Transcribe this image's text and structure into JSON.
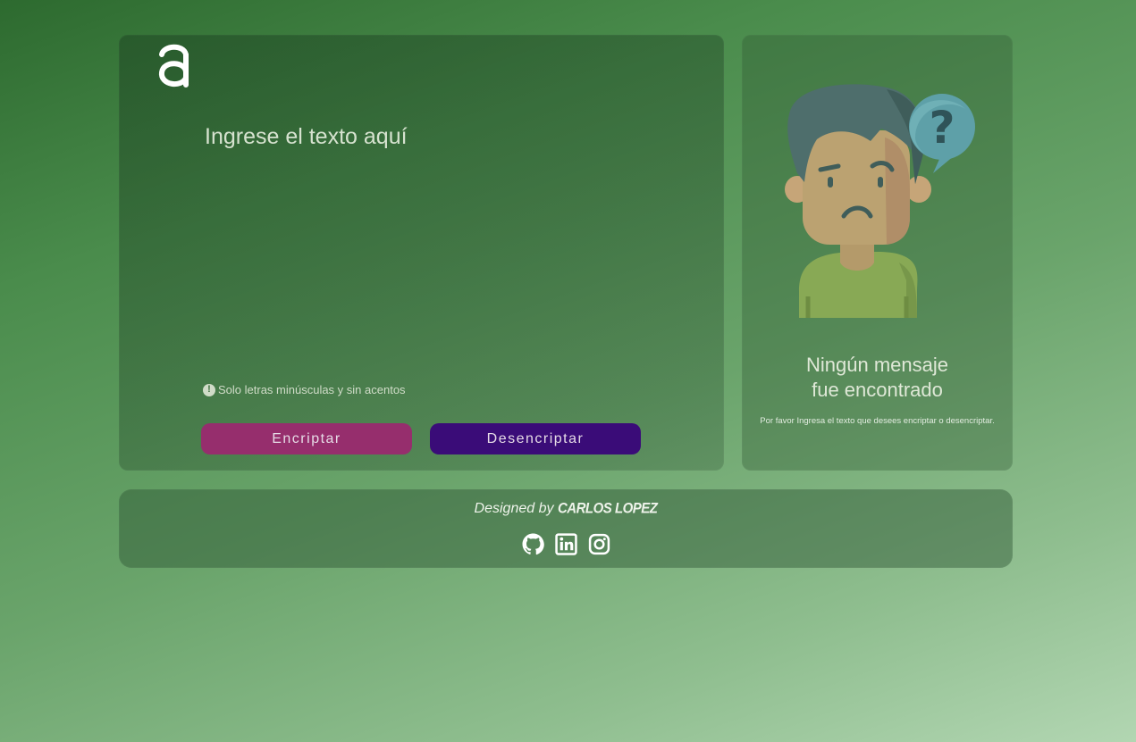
{
  "main": {
    "input_placeholder": "Ingrese el texto aquí",
    "hint_icon": "!",
    "hint_text": "Solo letras minúsculas y sin acentos",
    "encrypt_label": "Encriptar",
    "decrypt_label": "Desencriptar"
  },
  "side": {
    "title_line1": "Ningún mensaje",
    "title_line2": "fue encontrado",
    "subtitle": "Por favor Ingresa el texto que desees encriptar o desencriptar."
  },
  "footer": {
    "designed_by": "Designed by",
    "author": "CARLOS LOPEZ",
    "social_icons": [
      "github-icon",
      "linkedin-icon",
      "instagram-icon"
    ]
  },
  "colors": {
    "encrypt_button": "#962e6d",
    "decrypt_button": "#3a0c78"
  }
}
